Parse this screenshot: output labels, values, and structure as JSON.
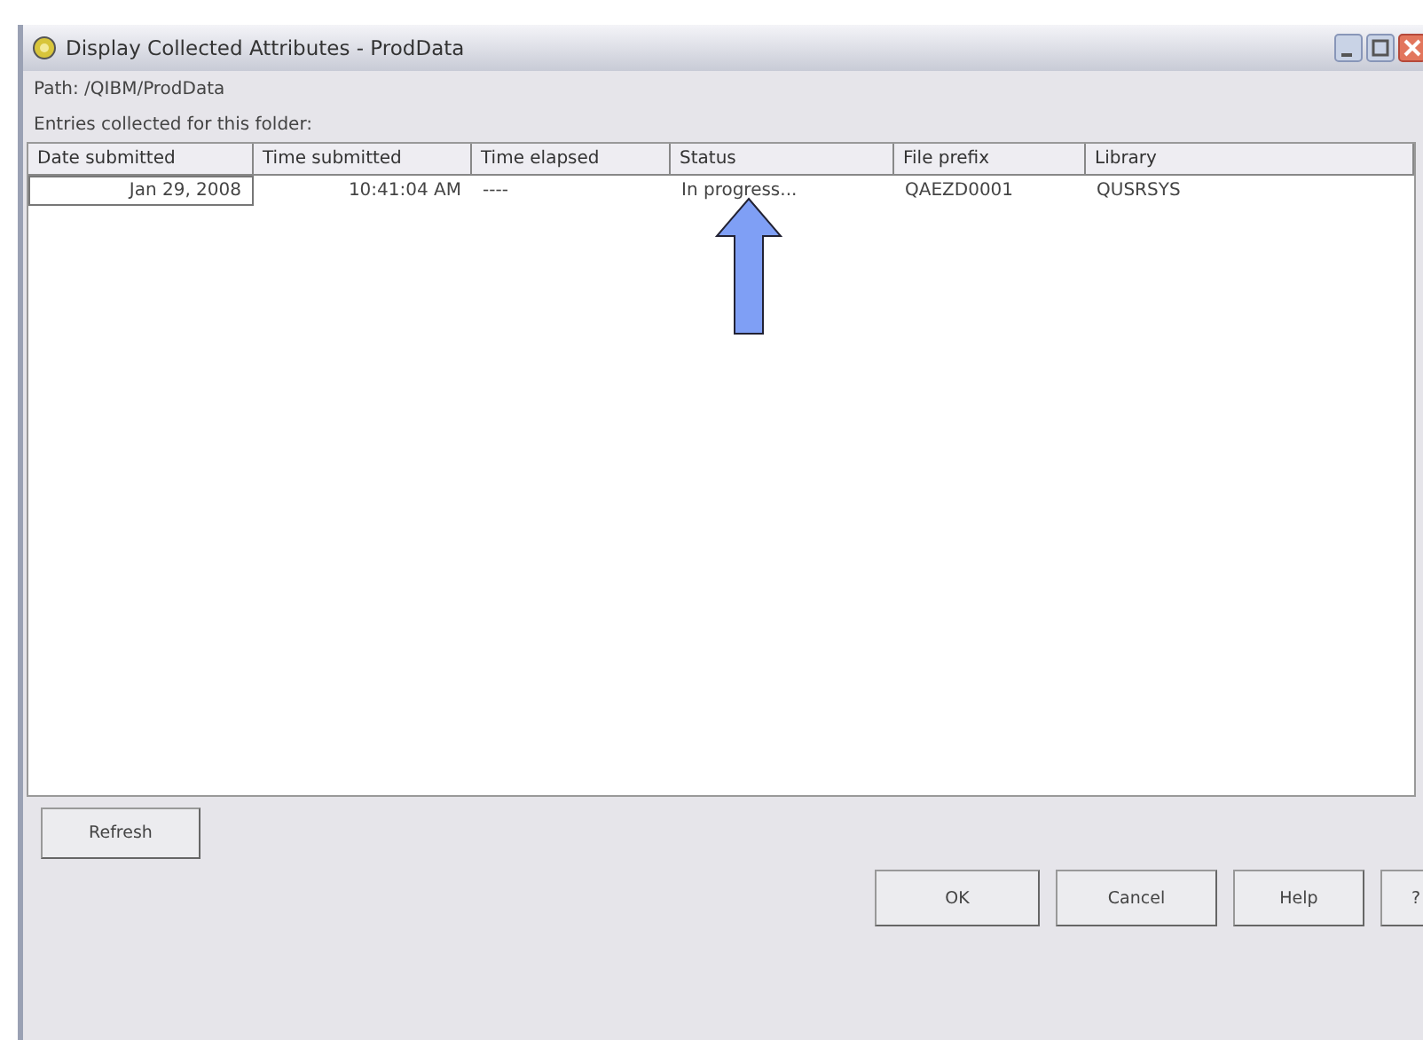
{
  "window": {
    "title": "Display Collected Attributes - ProdData"
  },
  "path_label": "Path:  /QIBM/ProdData",
  "entries_label": "Entries collected for this folder:",
  "table": {
    "columns": [
      "Date submitted",
      "Time submitted",
      "Time elapsed",
      "Status",
      "File prefix",
      "Library"
    ],
    "rows": [
      {
        "selected": false,
        "cells": [
          "Jan 29, 2008",
          "10:41:04 AM",
          "----",
          "In progress...",
          "QAEZD0001",
          "QUSRSYS"
        ]
      }
    ]
  },
  "buttons": [
    {
      "label": "Refresh",
      "kind": "side"
    },
    {
      "label": "OK",
      "kind": "footer"
    },
    {
      "label": "Cancel",
      "kind": "footer"
    },
    {
      "label": "Help",
      "kind": "footer"
    },
    {
      "label": "?",
      "kind": "footer"
    }
  ]
}
